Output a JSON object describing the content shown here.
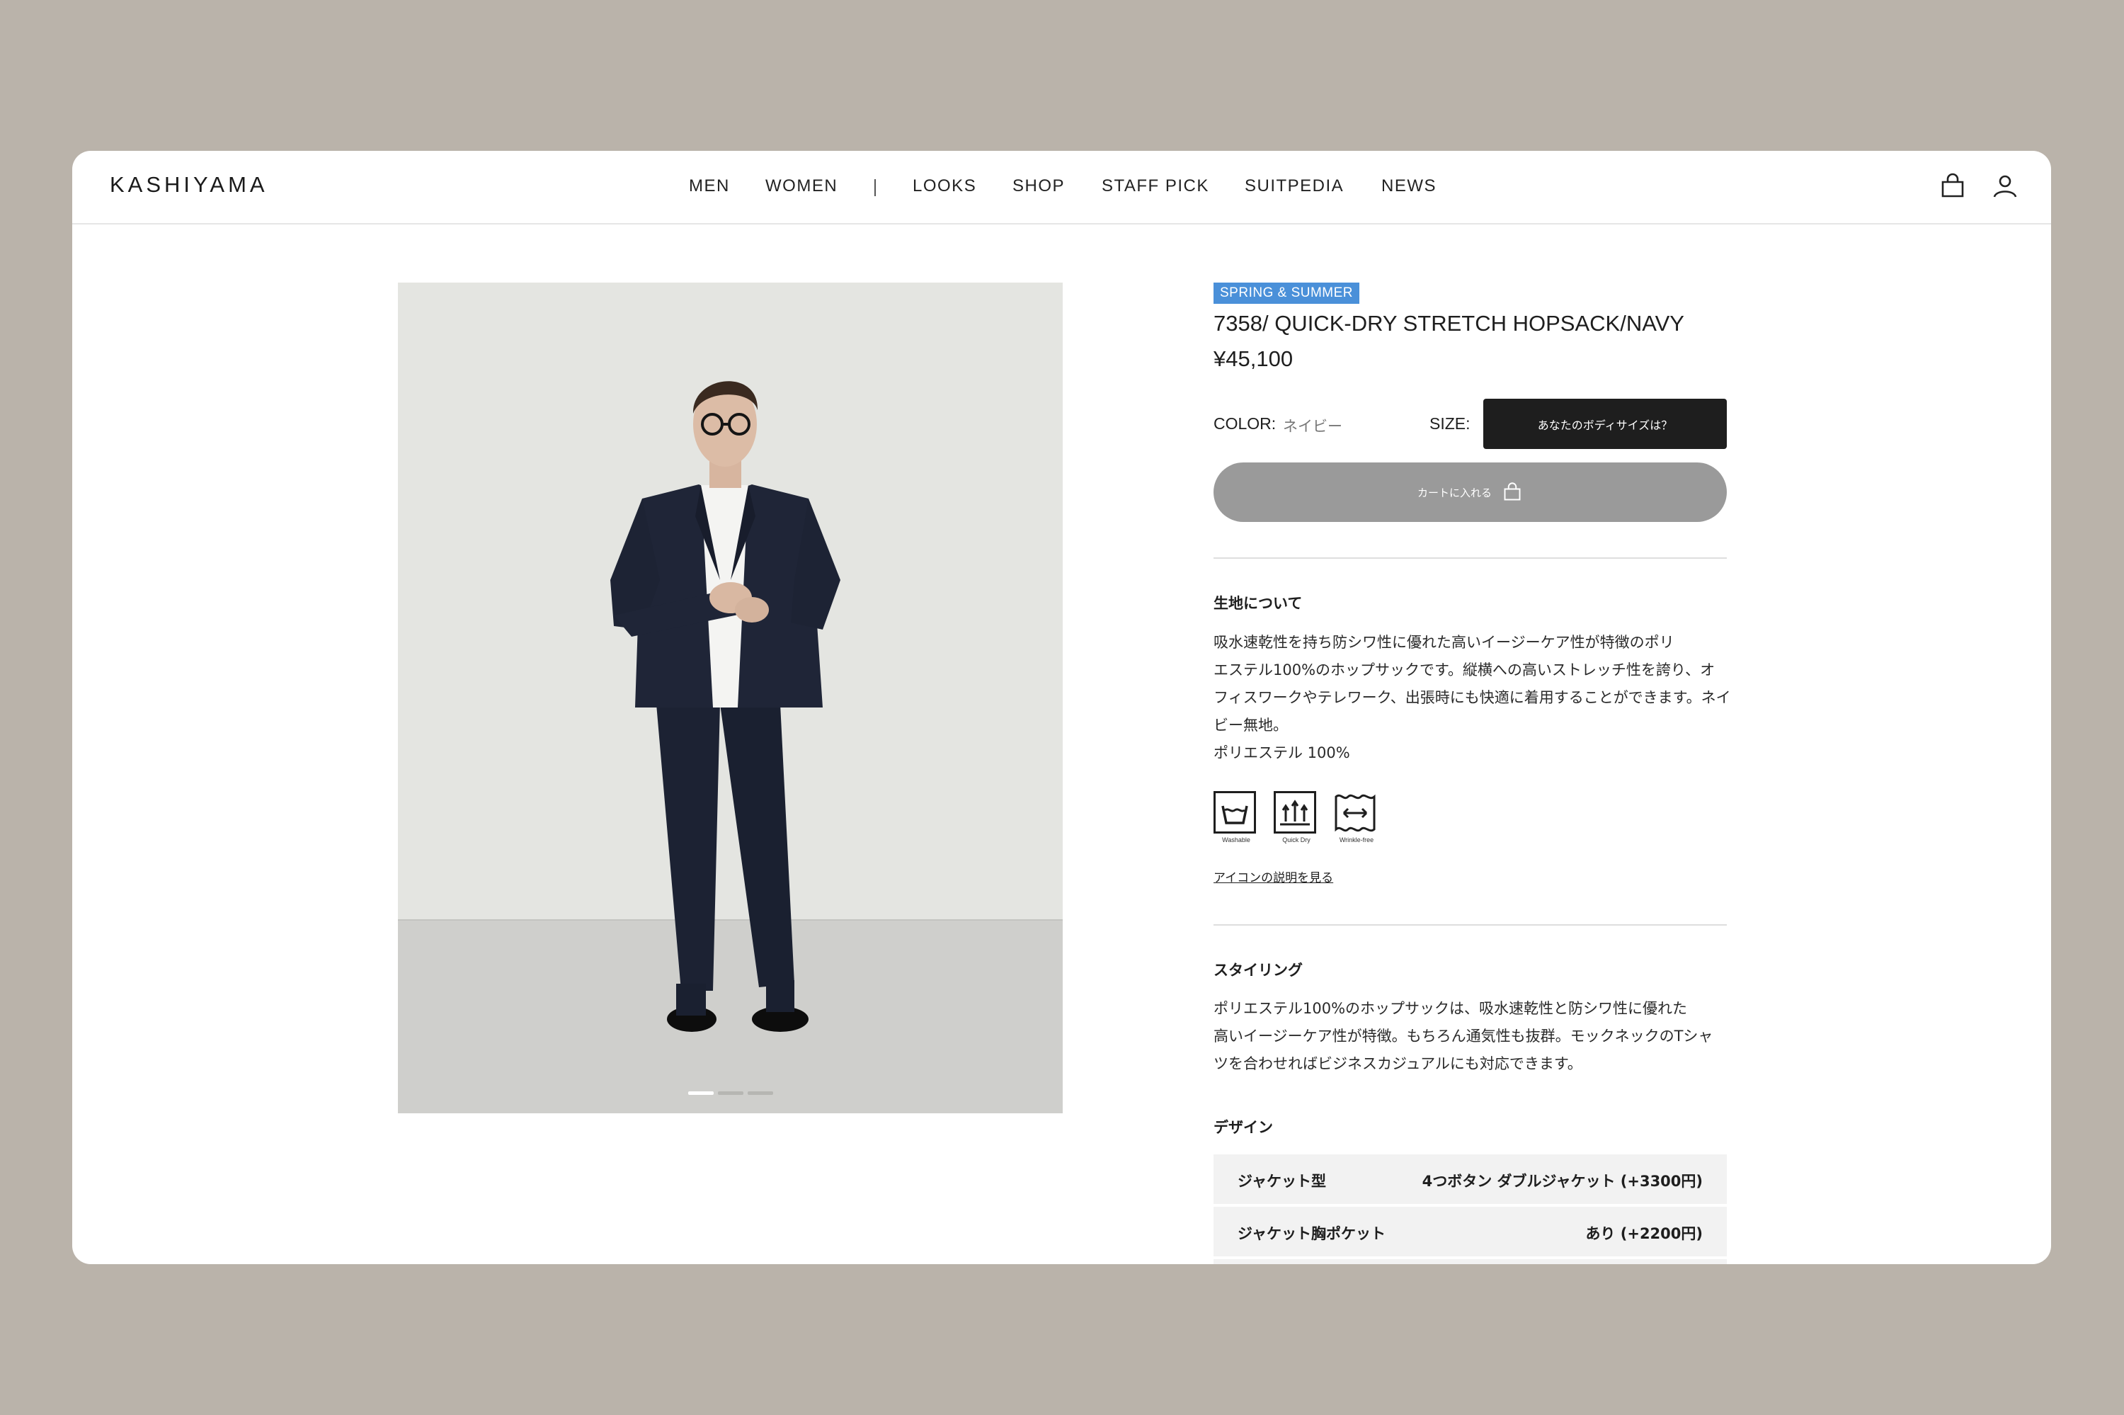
{
  "header": {
    "logo": "KASHIYAMA",
    "nav": [
      "MEN",
      "WOMEN",
      "LOOKS",
      "SHOP",
      "STAFF PICK",
      "SUITPEDIA",
      "NEWS"
    ],
    "icons": [
      "shopping-bag-icon",
      "user-icon"
    ]
  },
  "product": {
    "season_badge": "SPRING & SUMMER",
    "title": "7358/ QUICK-DRY STRETCH HOPSACK/NAVY",
    "price": "¥45,100",
    "color_label": "COLOR:",
    "color_value": "ネイビー",
    "size_label": "SIZE:",
    "size_button": "あなたのボディサイズは？",
    "cart_button": "カートに入れる",
    "carousel": {
      "count": 3,
      "active": 1
    }
  },
  "fabric": {
    "heading": "生地について",
    "lines": [
      "吸水速乾性を持ち防シワ性に優れた高いイージーケア性が特徴のポリ",
      "エステル100%のホップサックです。縦横への高いストレッチ性を誇り、オ",
      "フィスワークやテレワーク、出張時にも快適に着用することができます。ネイ",
      "ビー無地。",
      "ポリエステル 100%"
    ],
    "care_icons": [
      {
        "icon": "washable-icon",
        "label": "Washable"
      },
      {
        "icon": "quick-dry-icon",
        "label": "Quick Dry"
      },
      {
        "icon": "wrinkle-free-icon",
        "label": "Wrinkle-free"
      }
    ],
    "icon_link": "アイコンの説明を見る"
  },
  "styling": {
    "heading": "スタイリング",
    "lines": [
      "ポリエステル100%のホップサックは、吸水速乾性と防シワ性に優れた",
      "高いイージーケア性が特徴。もちろん通気性も抜群。モックネックのTシャ",
      "ツを合わせればビジネスカジュアルにも対応できます。"
    ]
  },
  "design": {
    "heading": "デザイン",
    "rows": [
      {
        "key": "ジャケット型",
        "value": "4つボタン ダブルジャケット (+3300円)"
      },
      {
        "key": "ジャケット胸ポケット",
        "value": "あり (+2200円)"
      }
    ]
  },
  "colors": {
    "badge": "#4a90d9",
    "size_button": "#1e1e1e",
    "cart_button": "#9a9a9a",
    "page_background": "#bab3aa"
  }
}
